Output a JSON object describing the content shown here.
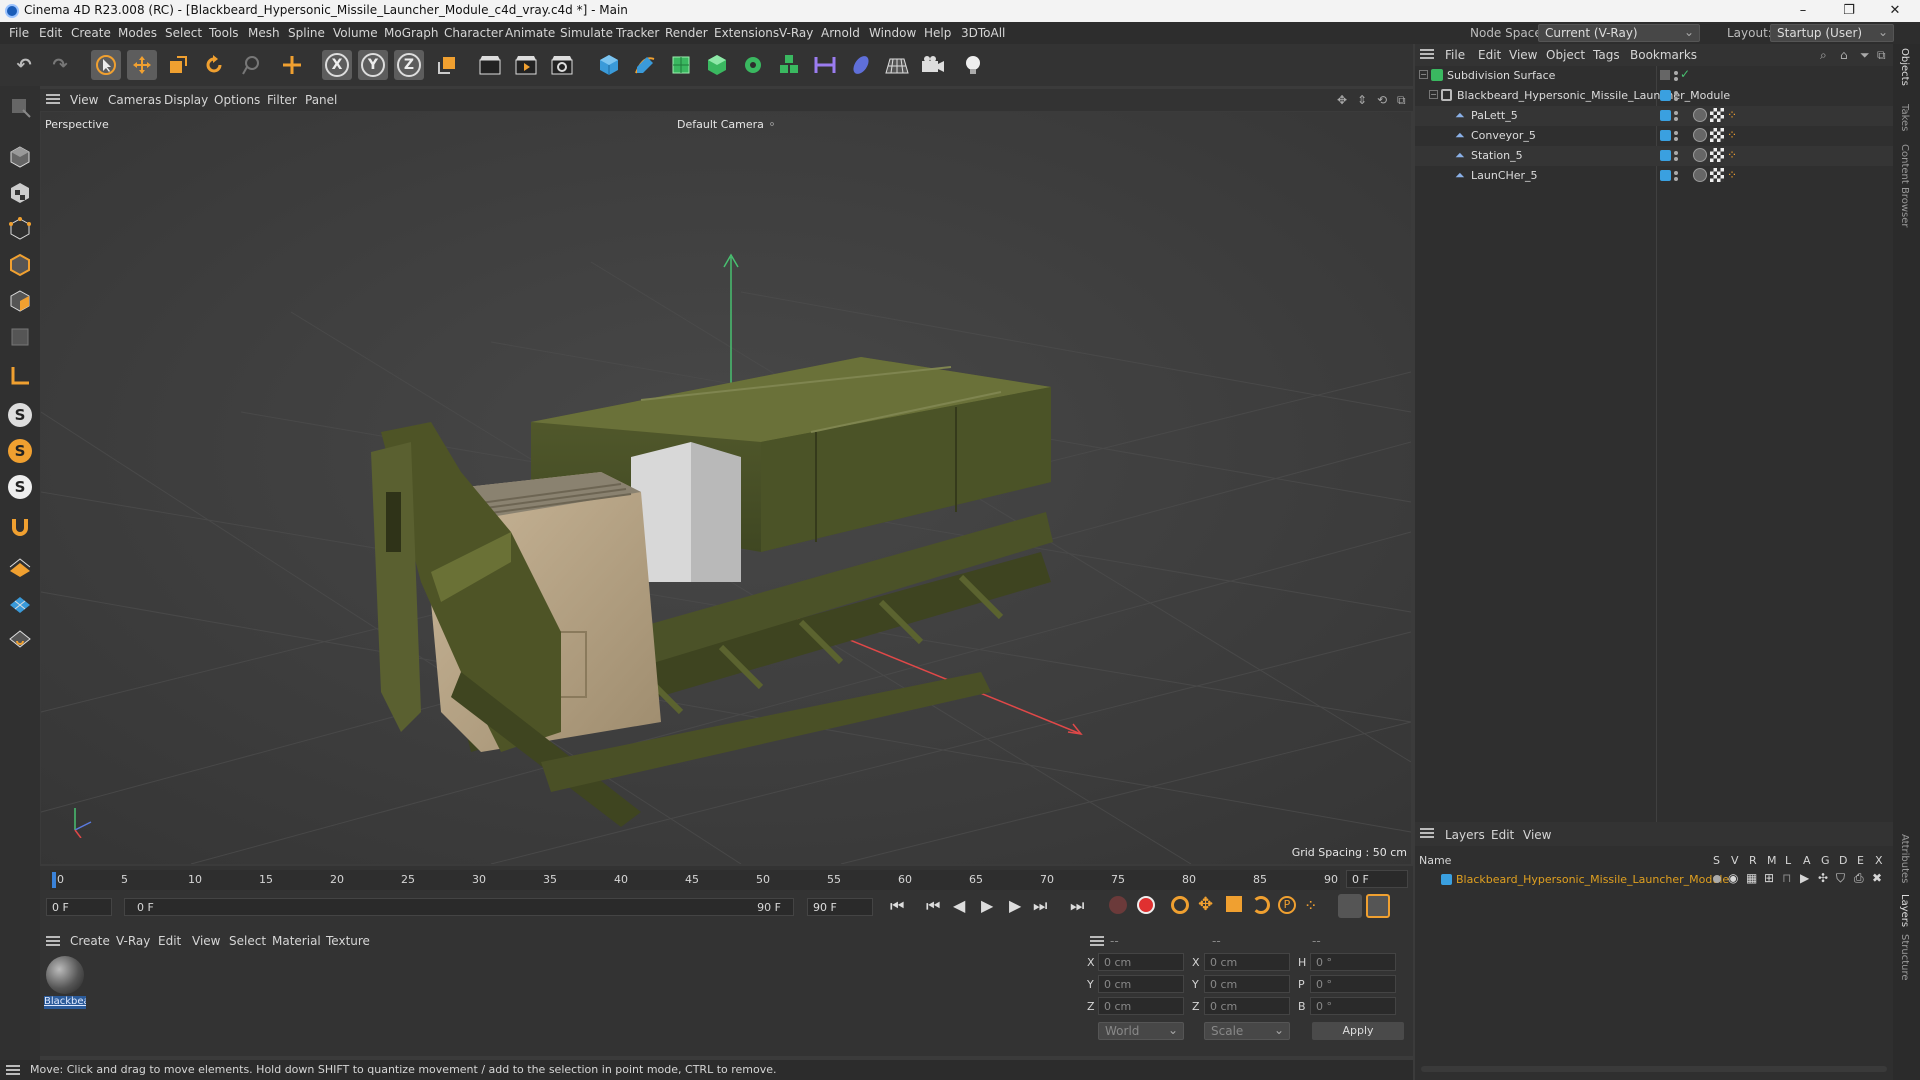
{
  "window": {
    "title": "Cinema 4D R23.008 (RC) - [Blackbeard_Hypersonic_Missile_Launcher_Module_c4d_vray.c4d *] - Main",
    "controls": [
      "–",
      "❐",
      "✕"
    ]
  },
  "menubar": {
    "items": [
      "File",
      "Edit",
      "Create",
      "Modes",
      "Select",
      "Tools",
      "Mesh",
      "Spline",
      "Volume",
      "MoGraph",
      "Character",
      "Animate",
      "Simulate",
      "Tracker",
      "Render",
      "Extensions",
      "V-Ray",
      "Arnold",
      "Window",
      "Help",
      "3DToAll"
    ],
    "node_space_label": "Node Space:",
    "node_space_value": "Current (V-Ray)",
    "layout_label": "Layout:",
    "layout_value": "Startup (User)"
  },
  "toolbar": {
    "undo": "↶",
    "redo": "↷",
    "x_label": "X",
    "y_label": "Y",
    "z_label": "Z"
  },
  "left_tools": {
    "s1": "S",
    "s2": "S",
    "s3": "S"
  },
  "viewport": {
    "menu": [
      "View",
      "Cameras",
      "Display",
      "Options",
      "Filter",
      "Panel"
    ],
    "label": "Perspective",
    "camera": "Default Camera",
    "camera_icon": "⚬",
    "grid_spacing": "Grid Spacing : 50 cm"
  },
  "timeline": {
    "ticks": [
      "0",
      "5",
      "10",
      "15",
      "20",
      "25",
      "30",
      "35",
      "40",
      "45",
      "50",
      "55",
      "60",
      "65",
      "70",
      "75",
      "80",
      "85",
      "90"
    ],
    "frame_end_display": "0 F",
    "start_field": "0 F",
    "range_start": "0 F",
    "range_end": "90 F",
    "end_field": "90 F"
  },
  "materials": {
    "menu": [
      "Create",
      "V-Ray",
      "Edit",
      "View",
      "Select",
      "Material",
      "Texture"
    ],
    "items": [
      {
        "name": "Blackbea"
      }
    ]
  },
  "coords": {
    "header": [
      "--",
      "--",
      "--"
    ],
    "rows": [
      {
        "a": "X",
        "av": "0 cm",
        "b": "X",
        "bv": "0 cm",
        "c": "H",
        "cv": "0 °"
      },
      {
        "a": "Y",
        "av": "0 cm",
        "b": "Y",
        "bv": "0 cm",
        "c": "P",
        "cv": "0 °"
      },
      {
        "a": "Z",
        "av": "0 cm",
        "b": "Z",
        "bv": "0 cm",
        "c": "B",
        "cv": "0 °"
      }
    ],
    "space": "World",
    "mode": "Scale",
    "apply": "Apply"
  },
  "status": "Move: Click and drag to move elements. Hold down SHIFT to quantize movement / add to the selection in point mode, CTRL to remove.",
  "objects": {
    "menu": [
      "File",
      "Edit",
      "View",
      "Object",
      "Tags",
      "Bookmarks"
    ],
    "items": [
      {
        "name": "Subdivision Surface"
      },
      {
        "name": "Blackbeard_Hypersonic_Missile_Launcher_Module"
      },
      {
        "name": "PaLett_5"
      },
      {
        "name": "Conveyor_5"
      },
      {
        "name": "Station_5"
      },
      {
        "name": "LaunCHer_5"
      }
    ]
  },
  "layers": {
    "menu": [
      "Layers",
      "Edit",
      "View"
    ],
    "name_header": "Name",
    "cols": [
      "S",
      "V",
      "R",
      "M",
      "L",
      "A",
      "G",
      "D",
      "E",
      "X"
    ],
    "items": [
      {
        "name": "Blackbeard_Hypersonic_Missile_Launcher_Module",
        "color": "#e0a020"
      }
    ]
  },
  "side_tabs": [
    "Objects",
    "Takes",
    "Content Browser",
    "Attributes",
    "Layers",
    "Structure"
  ],
  "colors": {
    "accent": "#2f8fe0",
    "object_blue": "#3aa0e0",
    "layer_orange": "#e0a020",
    "axis_x": "#e04848",
    "axis_y": "#48c070"
  }
}
